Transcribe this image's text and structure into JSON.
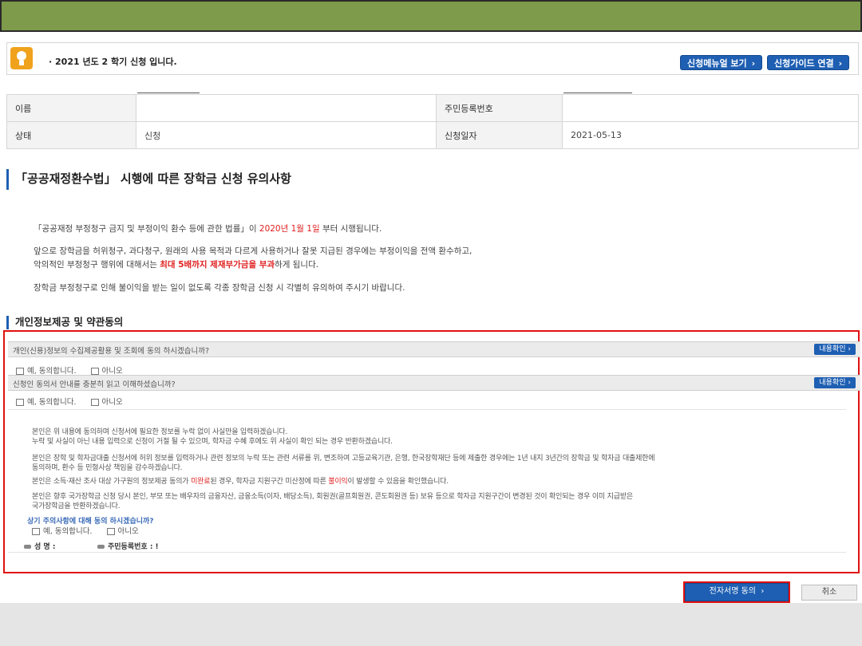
{
  "notice": {
    "text": "· 2021 년도 2 학기 신청 입니다.",
    "manual_button": "신청메뉴얼 보기",
    "guide_button": "신청가이드 연결",
    "chevron": "›",
    "icon": "lightbulb-icon"
  },
  "info": {
    "name_label": "이름",
    "name_value": "",
    "rrn_label": "주민등록번호",
    "rrn_value": "",
    "status_label": "상태",
    "status_value": "신청",
    "date_label": "신청일자",
    "date_value": "2021-05-13"
  },
  "notice_section": {
    "title": "「공공재정환수법」 시행에 따른 장학금 신청 유의사항",
    "p1_a": "「공공재정 부정청구 금지 및 부정이익 환수 등에 관한 법률」이 ",
    "p1_date": "2020년 1월 1일",
    "p1_b": " 부터 시행됩니다.",
    "p2": "앞으로 장학금을 허위청구, 과다청구, 원래의 사용 목적과 다르게 사용하거나 잘못 지급된 경우에는 부정이익을 전액 환수하고,",
    "p3_a": "악의적인 부정청구 행위에 대해서는 ",
    "p3_red": "최대 5배까지 제재부가금을 부과",
    "p3_b": "하게 됩니다.",
    "p4": "장학금 부정청구로 인해 불이익을 받는 일이 없도록 각종 장학금 신청 시 각별히 유의하여 주시기 바랍니다."
  },
  "consent": {
    "title": "개인정보제공 및 약관동의",
    "q1": "개인(신용)정보의 수집제공활용 및 조회에 동의 하시겠습니까?",
    "q2": "신청인 동의서 안내를 충분히 읽고 이해하셨습니까?",
    "view_button": "내용확인",
    "agree": "예, 동의합니다.",
    "disagree": "아니오",
    "terms": [
      "본인은 위 내용에 동의하며 신청서에 필요한 정보를 누락 없이 사실만을 입력하겠습니다.",
      "누락 및 사실이 아닌 내용 입력으로 신청이 거절 될 수 있으며, 학자금 수혜 후에도 위 사실이 확인 되는 경우 반환하겠습니다.",
      "본인은 장학 및 학자금대출 신청서에 허위 정보를 입력하거나 관련 정보의 누락 또는 관련 서류를 위, 변조하여 고등교육기관, 은행, 한국장학재단 등에 제출한 경우에는 1년 내지 3년간의 장학금 및 학자금 대출제한에",
      "동의하며, 환수 등 민형사상 책임을 감수하겠습니다.",
      "본인은 소득·재산 조사 대상 가구원의 정보제공 동의가 ",
      "된 경우, 학자금 지원구간 미산정에 따른 ",
      "이 발생할 수 있음을 확인했습니다.",
      "본인은 향후 국가장학금 신청 당시 본인, 부모 또는 배우자의 금융자산, 금융소득(이자, 배당소득), 회원권(골프회원권, 콘도회원권 등) 보유 등으로 학자금 지원구간이 변경된 것이 확인되는 경우 이미 지급받은",
      "국가장학금을 반환하겠습니다."
    ],
    "term_red1": "미완료",
    "term_red2": "불이익",
    "confirm_question": "상기 주의사항에 대해 동의 하시겠습니까?",
    "sig_name": "성 명 :",
    "sig_rrn": "주민등록번호 : !"
  },
  "actions": {
    "sign_button": "전자서명 동의",
    "sign_chevron": "›",
    "cancel_button": "취소"
  },
  "colors": {
    "banner": "#7d9b4b",
    "accent_blue": "#1e5fb3",
    "highlight_red": "#e01010"
  }
}
